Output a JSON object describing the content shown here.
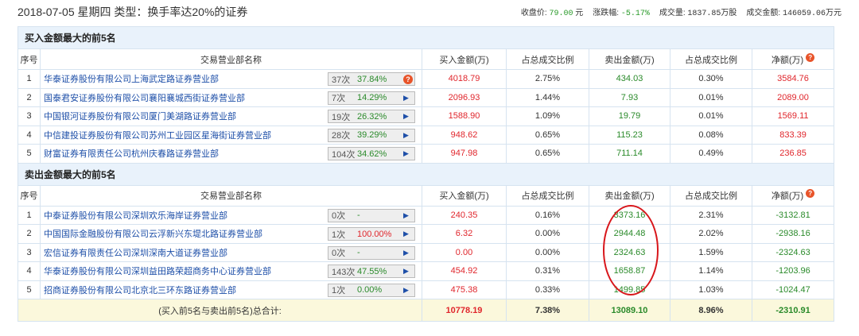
{
  "header": {
    "title": "2018-07-05 星期四  类型：换手率达20%的证券",
    "close_label": "收盘价:",
    "close": "79.00",
    "close_unit": "元",
    "change_label": "涨跌幅:",
    "change": "-5.17%",
    "volume_label": "成交量:",
    "volume": "1837.85万股",
    "amount_label": "成交金额:",
    "amount": "146059.06万元"
  },
  "columns": [
    "序号",
    "交易营业部名称",
    "买入金额(万)",
    "占总成交比例",
    "卖出金额(万)",
    "占总成交比例",
    "净额(万)"
  ],
  "buy_section": {
    "title": "买入金额最大的前5名",
    "rows": [
      {
        "no": "1",
        "name": "华泰证券股份有限公司上海武定路证券营业部",
        "count": "37次",
        "rate": "37.84%",
        "rate_color": "green",
        "icon": "question",
        "buy": "4018.79",
        "buy_pct": "2.75%",
        "sell": "434.03",
        "sell_pct": "0.30%",
        "net": "3584.76",
        "net_color": "red"
      },
      {
        "no": "2",
        "name": "国泰君安证券股份有限公司襄阳襄城西街证券营业部",
        "count": "7次",
        "rate": "14.29%",
        "rate_color": "green",
        "icon": "arrow",
        "buy": "2096.93",
        "buy_pct": "1.44%",
        "sell": "7.93",
        "sell_pct": "0.01%",
        "net": "2089.00",
        "net_color": "red"
      },
      {
        "no": "3",
        "name": "中国银河证券股份有限公司厦门美湖路证券营业部",
        "count": "19次",
        "rate": "26.32%",
        "rate_color": "green",
        "icon": "arrow",
        "buy": "1588.90",
        "buy_pct": "1.09%",
        "sell": "19.79",
        "sell_pct": "0.01%",
        "net": "1569.11",
        "net_color": "red"
      },
      {
        "no": "4",
        "name": "中信建投证券股份有限公司苏州工业园区星海街证券营业部",
        "count": "28次",
        "rate": "39.29%",
        "rate_color": "green",
        "icon": "arrow",
        "buy": "948.62",
        "buy_pct": "0.65%",
        "sell": "115.23",
        "sell_pct": "0.08%",
        "net": "833.39",
        "net_color": "red"
      },
      {
        "no": "5",
        "name": "财富证券有限责任公司杭州庆春路证券营业部",
        "count": "104次",
        "rate": "34.62%",
        "rate_color": "green",
        "icon": "arrow",
        "buy": "947.98",
        "buy_pct": "0.65%",
        "sell": "711.14",
        "sell_pct": "0.49%",
        "net": "236.85",
        "net_color": "red"
      }
    ]
  },
  "sell_section": {
    "title": "卖出金额最大的前5名",
    "rows": [
      {
        "no": "1",
        "name": "中泰证券股份有限公司深圳欢乐海岸证券营业部",
        "count": "0次",
        "rate": "-",
        "rate_color": "green",
        "icon": "arrow",
        "buy": "240.35",
        "buy_pct": "0.16%",
        "sell": "3373.16",
        "sell_pct": "2.31%",
        "net": "-3132.81",
        "net_color": "green"
      },
      {
        "no": "2",
        "name": "中国国际金融股份有限公司云浮新兴东堤北路证券营业部",
        "count": "1次",
        "rate": "100.00%",
        "rate_color": "red",
        "icon": "arrow",
        "buy": "6.32",
        "buy_pct": "0.00%",
        "sell": "2944.48",
        "sell_pct": "2.02%",
        "net": "-2938.16",
        "net_color": "green"
      },
      {
        "no": "3",
        "name": "宏信证券有限责任公司深圳深南大道证券营业部",
        "count": "0次",
        "rate": "-",
        "rate_color": "green",
        "icon": "arrow",
        "buy": "0.00",
        "buy_pct": "0.00%",
        "sell": "2324.63",
        "sell_pct": "1.59%",
        "net": "-2324.63",
        "net_color": "green"
      },
      {
        "no": "4",
        "name": "华泰证券股份有限公司深圳益田路荣超商务中心证券营业部",
        "count": "143次",
        "rate": "47.55%",
        "rate_color": "green",
        "icon": "arrow",
        "buy": "454.92",
        "buy_pct": "0.31%",
        "sell": "1658.87",
        "sell_pct": "1.14%",
        "net": "-1203.96",
        "net_color": "green"
      },
      {
        "no": "5",
        "name": "招商证券股份有限公司北京北三环东路证券营业部",
        "count": "1次",
        "rate": "0.00%",
        "rate_color": "green",
        "icon": "arrow",
        "buy": "475.38",
        "buy_pct": "0.33%",
        "sell": "1499.85",
        "sell_pct": "1.03%",
        "net": "-1024.47",
        "net_color": "green"
      }
    ]
  },
  "total": {
    "label": "(买入前5名与卖出前5名)总合计:",
    "buy": "10778.19",
    "buy_pct": "7.38%",
    "sell": "13089.10",
    "sell_pct": "8.96%",
    "net": "-2310.91"
  }
}
